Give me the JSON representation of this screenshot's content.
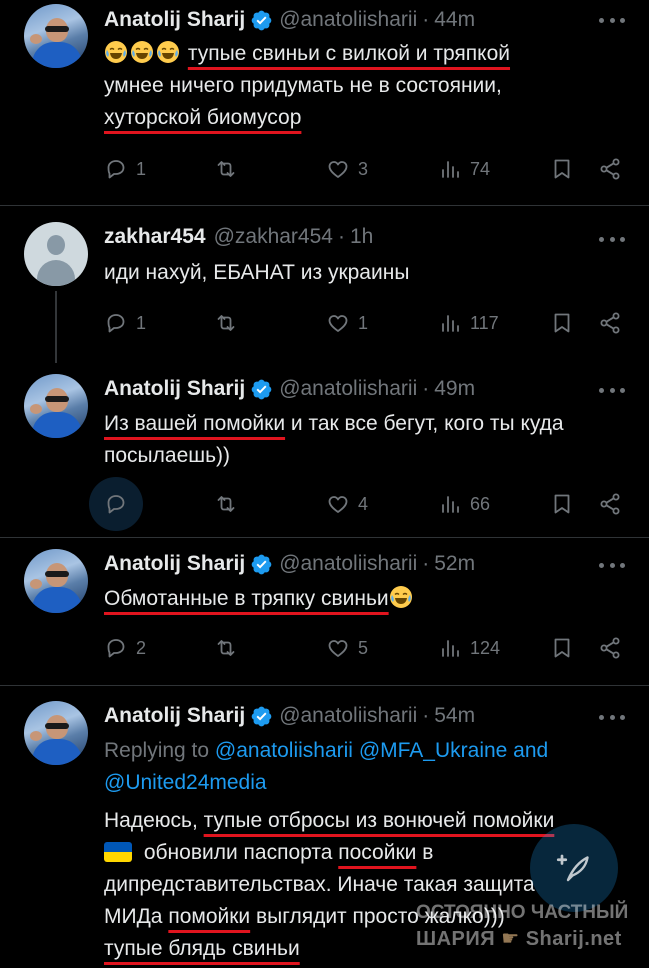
{
  "colors": {
    "accent": "#1d9bf0",
    "underline": "#e0141e",
    "muted": "#71767b",
    "text": "#e7e9ea"
  },
  "tweets": [
    {
      "name": "Anatolij Sharij",
      "verified": true,
      "handle": "@anatoliisharii",
      "time": "44m",
      "emoji_prefix": [
        "face-with-tears-of-joy",
        "face-with-tears-of-joy",
        "face-with-tears-of-joy"
      ],
      "text": {
        "line1_underlined": "тупые свиньи с вилкой и тряпкой",
        "line2": "умнее ничего придумать не в состоянии,",
        "line3_underlined": "хуторской биомусор"
      },
      "stats": {
        "replies": "1",
        "retweets": "",
        "likes": "3",
        "views": "74"
      }
    },
    {
      "name": "zakhar454",
      "verified": false,
      "handle": "@zakhar454",
      "time": "1h",
      "text": {
        "line1": "иди нахуй, ЕБАНАТ из украины"
      },
      "stats": {
        "replies": "1",
        "retweets": "",
        "likes": "1",
        "views": "117"
      }
    },
    {
      "name": "Anatolij Sharij",
      "verified": true,
      "handle": "@anatoliisharii",
      "time": "49m",
      "text": {
        "line1_underlined": "Из вашей помойки",
        "line1_rest": " и так все бегут, кого ты куда",
        "line2": "посылаешь))"
      },
      "stats": {
        "replies": "",
        "retweets": "",
        "likes": "4",
        "views": "66"
      }
    },
    {
      "name": "Anatolij Sharij",
      "verified": true,
      "handle": "@anatoliisharii",
      "time": "52m",
      "text": {
        "line1_underlined": "Обмотанные в тряпку свиньи",
        "emoji_suffix": "face-with-tears-of-joy"
      },
      "stats": {
        "replies": "2",
        "retweets": "",
        "likes": "5",
        "views": "124"
      }
    },
    {
      "name": "Anatolij Sharij",
      "verified": true,
      "handle": "@anatoliisharii",
      "time": "54m",
      "replying_to": {
        "prefix": "Replying to ",
        "mention1": "@anatoliisharii",
        "mention2": "@MFA_Ukraine",
        "and": " and",
        "mention3": "@United24media"
      },
      "text": {
        "p1": "Надеюсь, ",
        "p1_underlined": "тупые отбросы из вонючей помойки",
        "flag": "ukraine-flag",
        "p2": " обновили паспорта ",
        "p2_underlined": "посойки",
        "p2_rest": " в",
        "p3": "дипредставительствах. Иначе такая защита",
        "p4": "МИДа ",
        "p4_underlined": "помойки",
        "p4_rest": " выглядит просто жалко)))",
        "p5_underlined": "тупые блядь свиньи"
      }
    }
  ],
  "compose_button": {
    "icon": "feather-plus-icon"
  },
  "watermark": {
    "line1": "ОСТОЯННО ЧАСТНЫЙ",
    "line2_a": "ШАРИЯ",
    "line2_b": "Sharij.net"
  }
}
